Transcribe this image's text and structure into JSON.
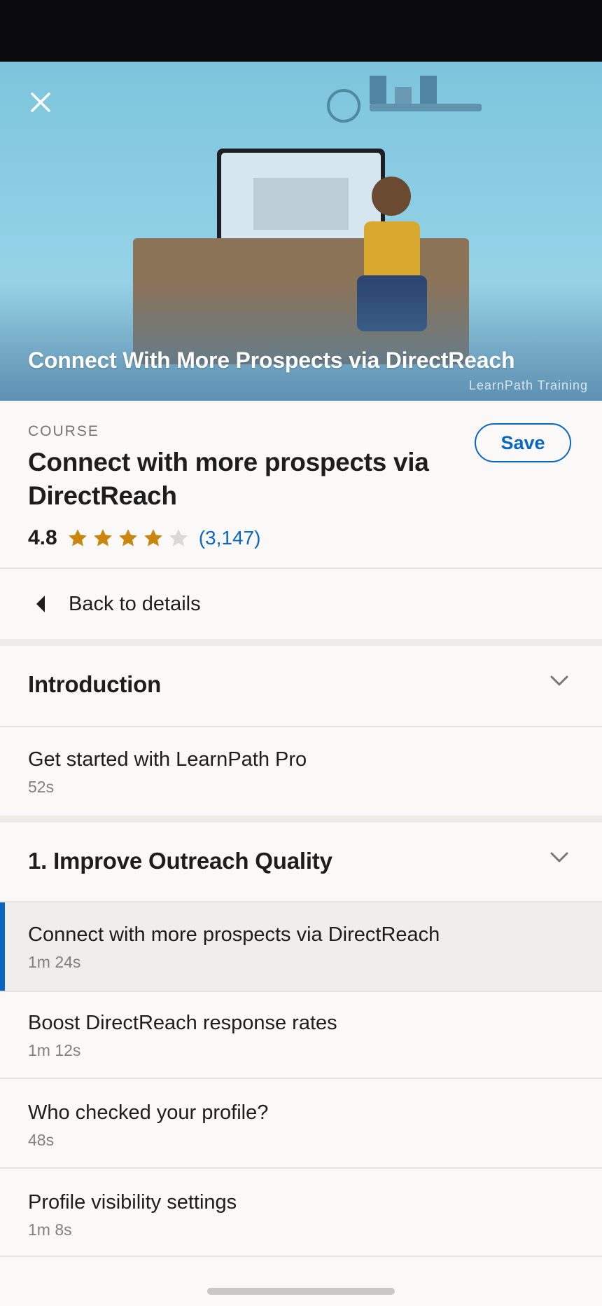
{
  "hero": {
    "title": "Connect With More Prospects via DirectReach",
    "brand": "LearnPath Training"
  },
  "course": {
    "eyebrow": "COURSE",
    "title": "Connect with more prospects via DirectReach",
    "save_label": "Save",
    "rating": "4.8",
    "rating_stars": 4,
    "rating_max": 5,
    "rating_count": "(3,147)"
  },
  "nav": {
    "back_label": "Back to details"
  },
  "sections": [
    {
      "title": "Introduction",
      "lessons": [
        {
          "name": "Get started with LearnPath Pro",
          "duration": "52s"
        }
      ]
    },
    {
      "title": "1. Improve Outreach Quality",
      "lessons": [
        {
          "name": "Connect with more prospects via DirectReach",
          "duration": "1m 24s",
          "active": true
        },
        {
          "name": "Boost DirectReach response rates",
          "duration": "1m 12s"
        },
        {
          "name": "Who checked your profile?",
          "duration": "48s"
        },
        {
          "name": "Profile visibility settings",
          "duration": "1m 8s"
        }
      ]
    }
  ],
  "colors": {
    "accent": "#0a66c2",
    "star": "#c9870f",
    "star_empty": "#d9d9d9"
  }
}
